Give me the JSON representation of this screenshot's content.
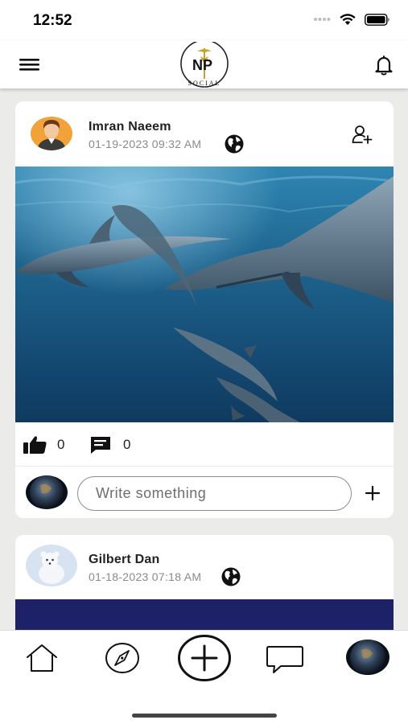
{
  "status_bar": {
    "time": "12:52"
  },
  "header": {
    "logo_letters": "NP",
    "logo_subtitle": "SOCIAL"
  },
  "posts": [
    {
      "author": "Imran Naeem",
      "date": "01-19-2023 09:32 AM",
      "likes": "0",
      "comments": "0",
      "comment_placeholder": "Write something"
    },
    {
      "author": "Gilbert Dan",
      "date": "01-18-2023 07:18 AM"
    }
  ],
  "icons": {
    "menu": "menu-icon",
    "bell": "bell-icon",
    "globe": "globe-icon",
    "follow": "add-user-icon",
    "like": "thumbs-up-icon",
    "comment": "comment-icon",
    "add": "plus-icon",
    "nav": [
      "home-icon",
      "compass-icon",
      "add-circle-icon",
      "chat-icon",
      "profile-avatar"
    ]
  },
  "colors": {
    "feed_background": "#ebebea",
    "logo_gold": "#c9a227",
    "card_2_image": "#1d2168"
  }
}
